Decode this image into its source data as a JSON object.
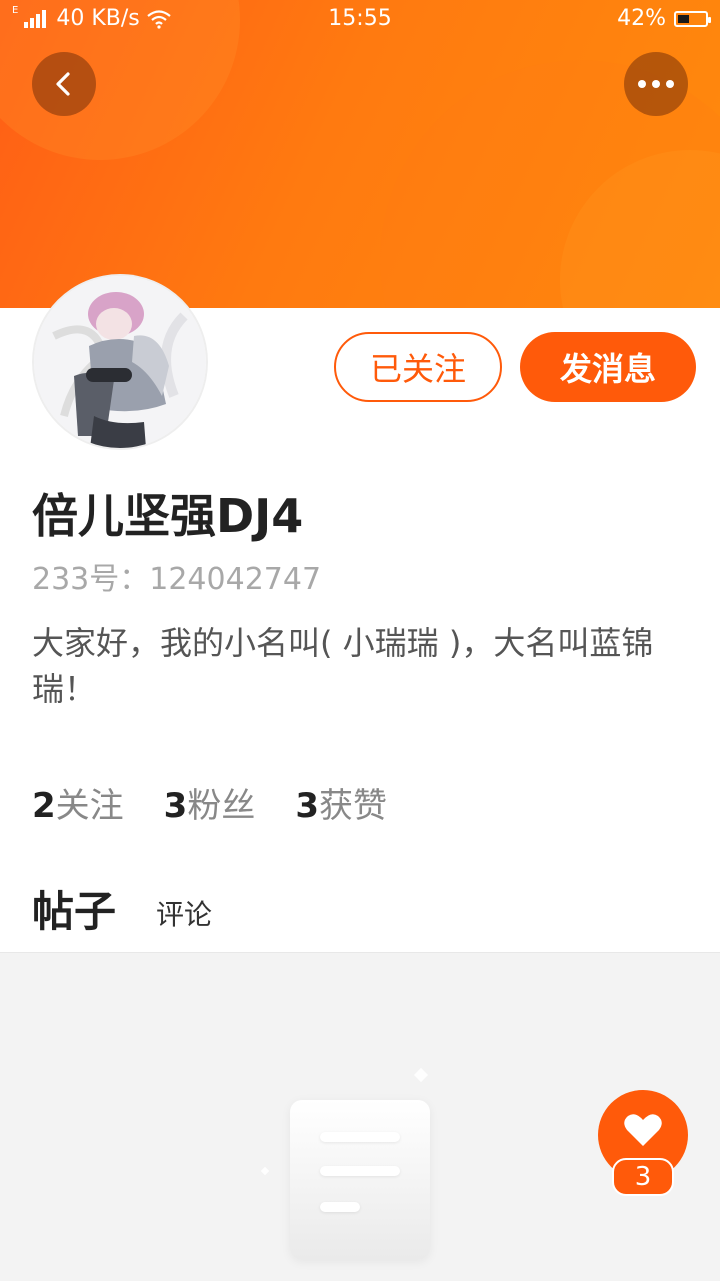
{
  "status_bar": {
    "network_type": "E",
    "speed": "40 KB/s",
    "time": "15:55",
    "battery": "42%",
    "battery_level": 0.42
  },
  "header": {
    "back_icon": "chevron-left-icon",
    "more_icon": "more-dots-icon"
  },
  "profile": {
    "follow_button": "已关注",
    "message_button": "发消息",
    "username": "倍儿坚强DJ4",
    "user_id": "233号：124042747",
    "bio": "大家好，我的小名叫(  小瑞瑞  )，大名叫蓝锦瑞！"
  },
  "stats": [
    {
      "count": "2",
      "label": "关注"
    },
    {
      "count": "3",
      "label": "粉丝"
    },
    {
      "count": "3",
      "label": "获赞"
    }
  ],
  "tabs": [
    {
      "label": "帖子",
      "active": true
    },
    {
      "label": "评论",
      "active": false
    }
  ],
  "like_fab": {
    "icon": "heart-icon",
    "count": "3"
  },
  "colors": {
    "accent": "#ff5a0a",
    "banner_start": "#ff5e16",
    "banner_end": "#ff8a0c"
  }
}
